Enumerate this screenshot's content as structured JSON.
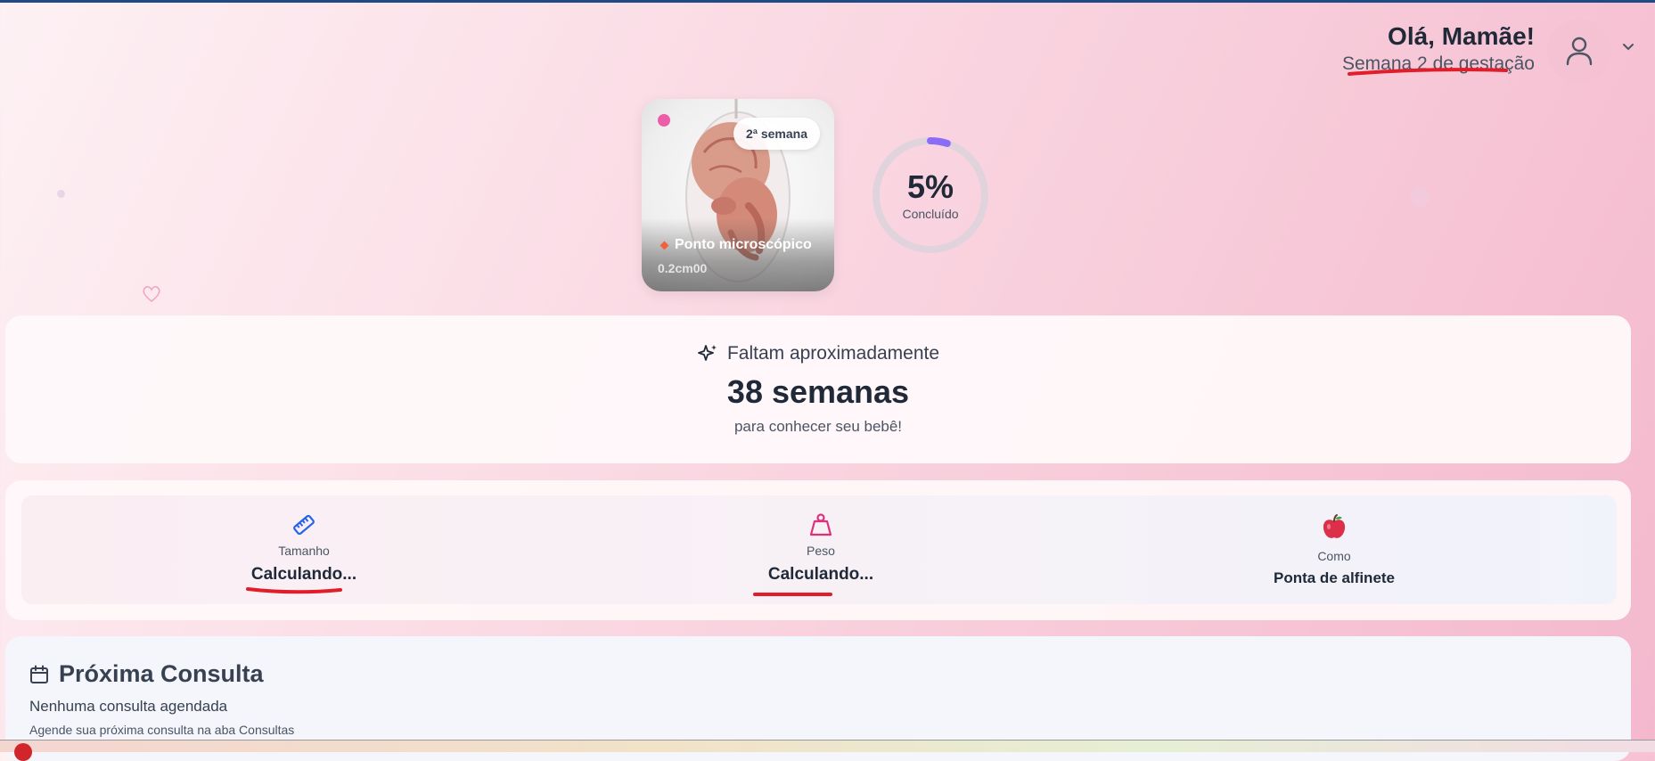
{
  "header": {
    "greeting": "Olá, Mamãe!",
    "week_status": "Semana 2 de gestação",
    "avatar_icon": "user-icon",
    "menu_icon": "chevron-down-icon"
  },
  "fetus_card": {
    "week_badge": "2ª semana",
    "size_name": "Ponto microscópico",
    "size_value": "0.2cm00"
  },
  "progress": {
    "percent_text": "5%",
    "label": "Concluído",
    "value": 0.05,
    "track_color": "#e0d3dc",
    "fill_color": "#8b6cf6"
  },
  "countdown": {
    "heading": "Faltam aproximadamente",
    "weeks": "38 semanas",
    "subtext": "para conhecer seu bebê!",
    "icon": "sparkles-icon"
  },
  "stats": [
    {
      "icon": "ruler-icon",
      "label": "Tamanho",
      "value": "Calculando..."
    },
    {
      "icon": "weight-icon",
      "label": "Peso",
      "value": "Calculando..."
    },
    {
      "icon": "apple-icon",
      "label": "Como",
      "value": "Ponta de alfinete"
    }
  ],
  "consultation": {
    "title": "Próxima Consulta",
    "icon": "calendar-icon",
    "empty_text": "Nenhuma consulta agendada",
    "hint": "Agende sua próxima consulta na aba Consultas"
  },
  "colors": {
    "accent_pink": "#e0307a",
    "accent_blue": "#2563eb",
    "annotation_red": "#e11d2a"
  }
}
